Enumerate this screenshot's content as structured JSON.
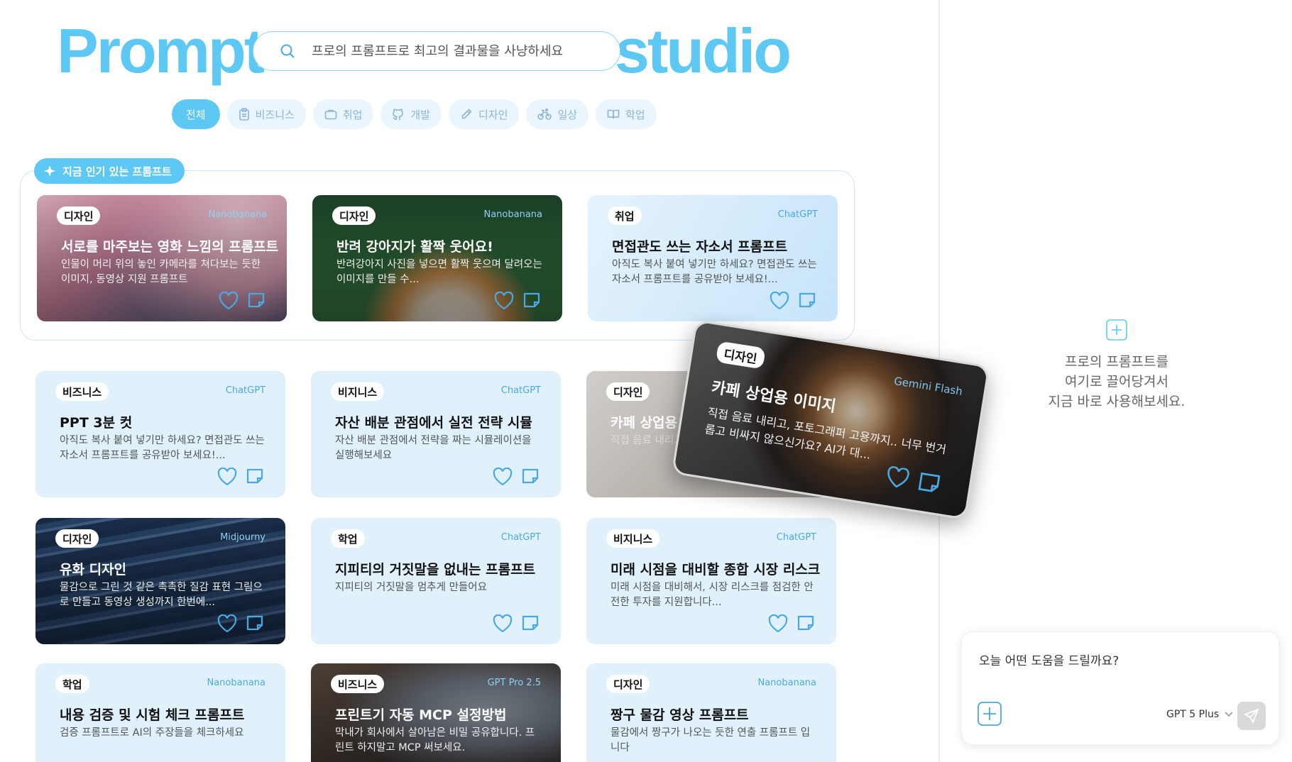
{
  "header": {
    "logo_left": "Prompt",
    "logo_right": "studio",
    "search_placeholder": "프로의 프롬프트로 최고의 결과물을 사냥하세요"
  },
  "categories": [
    {
      "label": "전체",
      "icon": "none",
      "active": true
    },
    {
      "label": "비즈니스",
      "icon": "clipboard-icon",
      "active": false
    },
    {
      "label": "취업",
      "icon": "briefcase-icon",
      "active": false
    },
    {
      "label": "개발",
      "icon": "github-icon",
      "active": false
    },
    {
      "label": "디자인",
      "icon": "pen-icon",
      "active": false
    },
    {
      "label": "일상",
      "icon": "bike-icon",
      "active": false
    },
    {
      "label": "학업",
      "icon": "book-icon",
      "active": false
    }
  ],
  "popular": {
    "badge": "지금 인기 있는 프롬프트",
    "cards": [
      {
        "tag": "디자인",
        "model": "Nanobanana",
        "title": "서로를 마주보는 영화 느낌의 프롬프트",
        "desc": "인물이 머리 위의 놓인 카메라를 쳐다보는 듯한 이미지, 동영상 지원 프롬프트"
      },
      {
        "tag": "디자인",
        "model": "Nanobanana",
        "title": "반려 강아지가 활짝 웃어요!",
        "desc": "반려강아지 사진을 넣으면 활짝 웃으며 달려오는 이미지를 만들 수..."
      },
      {
        "tag": "취업",
        "model": "ChatGPT",
        "title": "면접관도 쓰는 자소서 프롬프트",
        "desc": "아직도 복사 붙여 넣기만 하세요? 면접관도 쓰는 자소서 프롬프트를 공유받아 보세요!..."
      }
    ]
  },
  "grid": [
    {
      "tag": "비즈니스",
      "model": "ChatGPT",
      "title": "PPT 3분 컷",
      "desc": "아직도 복사 붙여 넣기만 하세요? 면접관도 쓰는 자소서 프롬프트를 공유받아 보세요!..."
    },
    {
      "tag": "비지니스",
      "model": "ChatGPT",
      "title": "자산 배분 관점에서 실전 전략 시뮬",
      "desc": "자산 배분 관점에서 전략을 짜는 시뮬레이션을 실행해보세요"
    },
    {
      "tag": "디자인",
      "model": "",
      "title": "카페 상업용 이",
      "desc": "직접 음료 내리고 무 번거롭고 비싸"
    },
    {
      "tag": "디자인",
      "model": "Midjourny",
      "title": "유화 디자인",
      "desc": "물감으로 그린 것 같은 촉촉한 질감 표현 그림으로 만들고 동영상 생성까지 한번에..."
    },
    {
      "tag": "학업",
      "model": "ChatGPT",
      "title": "지피티의 거짓말을 없내는 프롬프트",
      "desc": "지피티의 거짓말을 멈추게 만들어요"
    },
    {
      "tag": "비지니스",
      "model": "ChatGPT",
      "title": "미래 시점을 대비할 종합 시장 리스크",
      "desc": "미래 시점을 대비해서, 시장 리스크를 점검한 안전한 투자를 지원합니다..."
    },
    {
      "tag": "학업",
      "model": "Nanobanana",
      "title": "내용 검증 및 시험 체크 프롬프트",
      "desc": "검증 프롬프트로 AI의 주장들을 체크하세요"
    },
    {
      "tag": "비즈니스",
      "model": "GPT Pro 2.5",
      "title": "프린트기 자동 MCP 설정방법",
      "desc": "막내가 회사에서 살아남은 비밀 공유합니다. 프린트 하지말고 MCP 써보세요."
    },
    {
      "tag": "디자인",
      "model": "Nanobanana",
      "title": "짱구 물감 영상 프롬프트",
      "desc": "물감에서 짱구가 나오는 듯한 연출 프롬프트 입니다"
    }
  ],
  "dragging_card": {
    "tag": "디자인",
    "model": "Gemini Flash",
    "title": "카페 상업용 이미지",
    "desc": "직접 음료 내리고, 포토그래퍼 고용까지.. 너무 번거롭고 비싸지 않으신가요? AI가 대..."
  },
  "drop_zone": {
    "message": "프로의 프롬프트를\n여기로 끌어당겨서\n지금 바로 사용해보세요."
  },
  "chat": {
    "placeholder": "오늘 어떤 도움을 드릴까요?",
    "model": "GPT 5 Plus"
  },
  "colors": {
    "accent": "#5ec8f4",
    "card_bg": "#e0f1fc",
    "chip_bg": "#eaf5fd",
    "chip_text": "#8ab5d8",
    "icon_blue": "#4aa9e0"
  }
}
